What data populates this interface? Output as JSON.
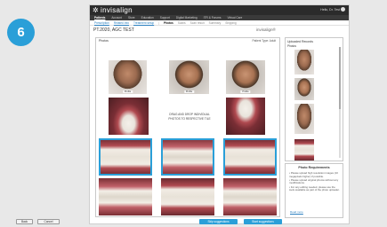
{
  "step_number": "6",
  "app": {
    "brand": "invisalign",
    "user_text": "Hello, Dr. Test",
    "nav": [
      "Patients",
      "Account",
      "Store",
      "Education",
      "Support",
      "Digital Marketing",
      "ITR & Forums",
      "Virtual Care"
    ],
    "subnav": [
      "Prescription",
      "Related Info",
      "Treatment setup",
      "Photos",
      "Scans",
      "Scan result",
      "Summary",
      "Shipping"
    ],
    "patient_name": "PT.2020, AGC TEST",
    "brand_small": "invisalign®"
  },
  "photos_panel": {
    "title": "Photos",
    "right_text": "Patient Type: Adult",
    "drag_hint": "DRAG AND DROP INDIVIDUAL PHOTOS TO RESPECTIVE TILE",
    "photo_label": "Profile"
  },
  "uploaded": {
    "title": "Uploaded Records",
    "subtitle": "Photos"
  },
  "requirements": {
    "title": "Photo Requirements",
    "items": [
      "Please upload high resolution images (10 megapixels higher) if possible.",
      "Please upload original photos without any modifications.",
      "For any editing needed, please use the tools available as part of the photo uploader."
    ],
    "link": "Read more"
  },
  "buttons": {
    "back": "Back",
    "cancel": "Cancel",
    "primary1": "Skip suggestions",
    "primary2": "Start suggestions"
  },
  "colors": {
    "accent": "#2a9fd8",
    "topbar": "#2b2b2b"
  }
}
